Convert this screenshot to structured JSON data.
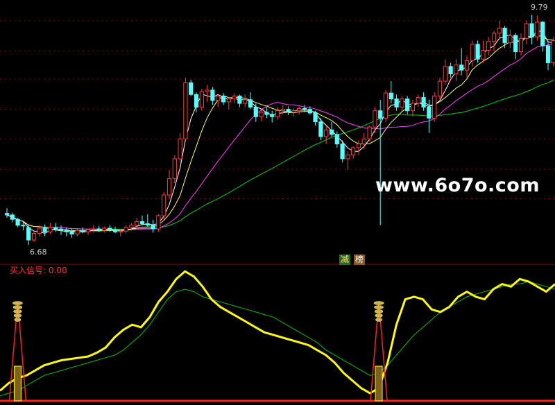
{
  "watermark": "www.6o7o.com",
  "indicator_title": "买入信号: 0.00",
  "badges": [
    "减",
    "榜"
  ],
  "colors": {
    "up": "#ff3c3c",
    "down": "#54ffff",
    "ma5": "#ffffff",
    "ma10": "#ffff66",
    "ma20": "#ff40ff",
    "ma60": "#00d000",
    "signal": "#ffff00",
    "signal_ma": "#00c000",
    "buy": "#ff2020",
    "grid": "#8b0000"
  },
  "chart_data": [
    {
      "type": "candlestick",
      "title": "",
      "annotations": [
        {
          "text": "9.79",
          "kind": "high",
          "index": 111
        },
        {
          "text": "6.68",
          "kind": "low",
          "index": 4
        }
      ],
      "ylim": [
        6.45,
        10.0
      ],
      "gridlines": [
        9.72,
        9.31,
        8.93,
        8.52,
        8.12,
        7.71,
        7.31
      ],
      "candles": [
        [
          7.11,
          7.18,
          7.05,
          7.09
        ],
        [
          7.09,
          7.12,
          6.99,
          7.03
        ],
        [
          7.03,
          7.05,
          6.92,
          6.95
        ],
        [
          6.95,
          7.0,
          6.88,
          6.94
        ],
        [
          6.92,
          6.95,
          6.68,
          6.75
        ],
        [
          6.75,
          6.86,
          6.72,
          6.84
        ],
        [
          6.84,
          6.95,
          6.8,
          6.91
        ],
        [
          6.91,
          6.96,
          6.8,
          6.86
        ],
        [
          6.86,
          6.98,
          6.83,
          6.92
        ],
        [
          6.92,
          6.98,
          6.86,
          6.9
        ],
        [
          6.9,
          6.95,
          6.82,
          6.88
        ],
        [
          6.88,
          6.92,
          6.8,
          6.86
        ],
        [
          6.86,
          6.9,
          6.78,
          6.83
        ],
        [
          6.83,
          6.9,
          6.8,
          6.88
        ],
        [
          6.88,
          6.92,
          6.84,
          6.86
        ],
        [
          6.86,
          6.9,
          6.82,
          6.89
        ],
        [
          6.89,
          6.95,
          6.85,
          6.9
        ],
        [
          6.9,
          6.94,
          6.86,
          6.88
        ],
        [
          6.88,
          6.93,
          6.85,
          6.91
        ],
        [
          6.91,
          6.95,
          6.86,
          6.89
        ],
        [
          6.89,
          6.93,
          6.84,
          6.86
        ],
        [
          6.86,
          6.9,
          6.8,
          6.87
        ],
        [
          6.87,
          6.95,
          6.84,
          6.92
        ],
        [
          6.92,
          6.98,
          6.88,
          6.95
        ],
        [
          6.95,
          7.05,
          6.9,
          7.0
        ],
        [
          7.0,
          7.08,
          6.95,
          6.97
        ],
        [
          6.97,
          7.1,
          6.93,
          6.95
        ],
        [
          6.95,
          7.02,
          6.85,
          6.9
        ],
        [
          6.9,
          7.1,
          6.86,
          7.08
        ],
        [
          7.08,
          7.4,
          7.02,
          7.36
        ],
        [
          7.36,
          7.7,
          7.3,
          7.58
        ],
        [
          7.58,
          7.9,
          7.52,
          7.85
        ],
        [
          7.85,
          8.2,
          7.8,
          8.12
        ],
        [
          8.12,
          8.95,
          8.1,
          8.88
        ],
        [
          8.88,
          8.92,
          8.7,
          8.72
        ],
        [
          8.72,
          8.75,
          8.48,
          8.55
        ],
        [
          8.55,
          8.8,
          8.5,
          8.76
        ],
        [
          8.76,
          8.85,
          8.62,
          8.78
        ],
        [
          8.78,
          8.82,
          8.58,
          8.64
        ],
        [
          8.64,
          8.72,
          8.55,
          8.7
        ],
        [
          8.7,
          8.74,
          8.58,
          8.62
        ],
        [
          8.62,
          8.68,
          8.52,
          8.66
        ],
        [
          8.66,
          8.74,
          8.6,
          8.7
        ],
        [
          8.7,
          8.72,
          8.55,
          8.6
        ],
        [
          8.6,
          8.72,
          8.55,
          8.65
        ],
        [
          8.65,
          8.75,
          8.52,
          8.55
        ],
        [
          8.55,
          8.6,
          8.35,
          8.42
        ],
        [
          8.42,
          8.52,
          8.36,
          8.48
        ],
        [
          8.48,
          8.55,
          8.4,
          8.45
        ],
        [
          8.45,
          8.5,
          8.34,
          8.42
        ],
        [
          8.42,
          8.55,
          8.38,
          8.5
        ],
        [
          8.5,
          8.58,
          8.45,
          8.52
        ],
        [
          8.52,
          8.56,
          8.44,
          8.48
        ],
        [
          8.48,
          8.54,
          8.42,
          8.5
        ],
        [
          8.5,
          8.56,
          8.45,
          8.53
        ],
        [
          8.53,
          8.58,
          8.48,
          8.52
        ],
        [
          8.52,
          8.56,
          8.45,
          8.47
        ],
        [
          8.47,
          8.5,
          8.3,
          8.35
        ],
        [
          8.35,
          8.4,
          8.1,
          8.15
        ],
        [
          8.15,
          8.3,
          8.05,
          8.24
        ],
        [
          8.24,
          8.35,
          8.15,
          8.18
        ],
        [
          8.18,
          8.22,
          8.0,
          8.05
        ],
        [
          8.05,
          8.1,
          7.8,
          7.85
        ],
        [
          7.85,
          7.95,
          7.7,
          7.9
        ],
        [
          7.9,
          8.02,
          7.85,
          8.0
        ],
        [
          8.0,
          8.1,
          7.9,
          8.05
        ],
        [
          8.05,
          8.2,
          7.98,
          8.12
        ],
        [
          8.12,
          8.3,
          8.08,
          8.28
        ],
        [
          8.28,
          8.55,
          8.2,
          8.5
        ],
        [
          8.5,
          8.65,
          6.95,
          8.4
        ],
        [
          8.4,
          8.78,
          8.35,
          8.74
        ],
        [
          8.74,
          8.9,
          8.6,
          8.66
        ],
        [
          8.66,
          8.72,
          8.5,
          8.55
        ],
        [
          8.55,
          8.7,
          8.48,
          8.66
        ],
        [
          8.66,
          8.7,
          8.45,
          8.5
        ],
        [
          8.5,
          8.65,
          8.42,
          8.6
        ],
        [
          8.6,
          8.72,
          8.55,
          8.68
        ],
        [
          8.68,
          8.75,
          8.5,
          8.55
        ],
        [
          8.55,
          8.65,
          8.2,
          8.4
        ],
        [
          8.4,
          8.75,
          8.35,
          8.7
        ],
        [
          8.7,
          8.95,
          8.65,
          8.9
        ],
        [
          8.9,
          9.2,
          8.85,
          9.1
        ],
        [
          9.1,
          9.15,
          8.95,
          9.0
        ],
        [
          9.0,
          9.2,
          8.9,
          9.12
        ],
        [
          9.12,
          9.35,
          8.98,
          9.05
        ],
        [
          9.05,
          9.25,
          8.95,
          9.18
        ],
        [
          9.18,
          9.45,
          9.1,
          9.4
        ],
        [
          9.4,
          9.45,
          9.15,
          9.2
        ],
        [
          9.2,
          9.45,
          9.15,
          9.32
        ],
        [
          9.32,
          9.5,
          9.25,
          9.44
        ],
        [
          9.44,
          9.58,
          9.3,
          9.55
        ],
        [
          9.55,
          9.72,
          9.45,
          9.62
        ],
        [
          9.62,
          9.65,
          9.35,
          9.42
        ],
        [
          9.42,
          9.6,
          9.35,
          9.52
        ],
        [
          9.52,
          9.55,
          9.2,
          9.3
        ],
        [
          9.3,
          9.55,
          9.25,
          9.48
        ],
        [
          9.48,
          9.72,
          9.4,
          9.68
        ],
        [
          9.68,
          9.8,
          9.4,
          9.5
        ],
        [
          9.5,
          9.79,
          9.45,
          9.7
        ],
        [
          9.7,
          9.72,
          9.3,
          9.38
        ],
        [
          9.38,
          9.45,
          9.05,
          9.15
        ],
        [
          9.15,
          9.5,
          9.1,
          9.45
        ]
      ],
      "x_note": "",
      "ma": {
        "ma5": [],
        "ma10": [],
        "ma20": [],
        "ma60": []
      }
    },
    {
      "type": "line",
      "title": "买入信号: 0.00",
      "ylim": [
        0,
        100
      ],
      "series": [
        {
          "name": "",
          "color": "#ffff00",
          "values": [
            8,
            14,
            18,
            20,
            24,
            28,
            30,
            32,
            33,
            34,
            35,
            38,
            42,
            50,
            56,
            60,
            58,
            66,
            78,
            86,
            96,
            102,
            98,
            90,
            80,
            74,
            70,
            66,
            62,
            58,
            54,
            52,
            50,
            48,
            46,
            44,
            40,
            36,
            30,
            22,
            16,
            10,
            6,
            10,
            30,
            60,
            80,
            82,
            80,
            72,
            70,
            74,
            82,
            86,
            82,
            80,
            88,
            92,
            90,
            96,
            94,
            90,
            86,
            92
          ]
        },
        {
          "name": "",
          "color": "#00c000",
          "values": [
            4,
            6,
            8,
            12,
            16,
            20,
            22,
            24,
            26,
            28,
            30,
            32,
            34,
            36,
            40,
            46,
            52,
            60,
            70,
            80,
            86,
            88,
            86,
            82,
            80,
            78,
            76,
            74,
            72,
            70,
            68,
            66,
            62,
            58,
            54,
            50,
            46,
            40,
            36,
            32,
            28,
            24,
            20,
            22,
            28,
            36,
            44,
            52,
            58,
            64,
            70,
            74,
            78,
            82,
            84,
            86,
            88,
            90,
            92,
            92,
            94,
            92,
            90,
            88
          ]
        }
      ],
      "markers": [
        {
          "type": "buy",
          "index": 2
        },
        {
          "type": "buy",
          "index": 43
        }
      ]
    }
  ]
}
